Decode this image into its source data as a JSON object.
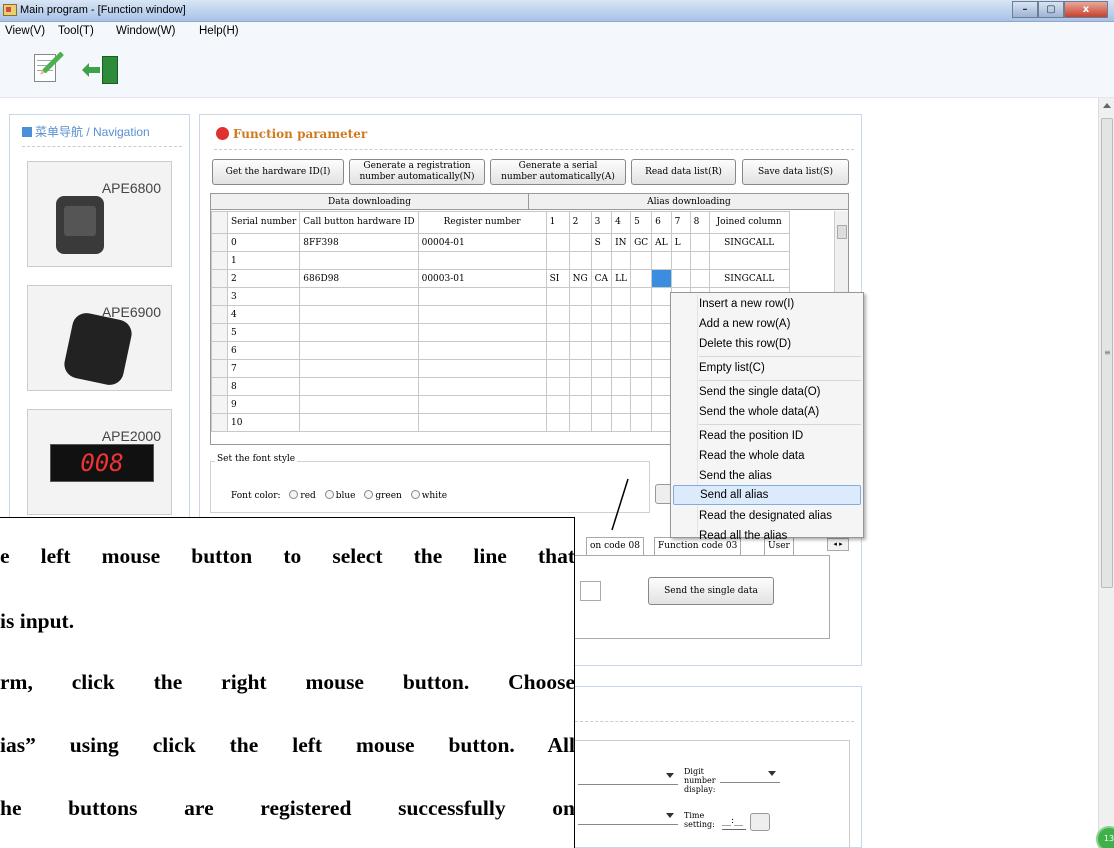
{
  "window": {
    "title": "Main program - [Function window]",
    "controls": {
      "minimize": "–",
      "maximize": "▢",
      "close": "x"
    }
  },
  "menu": [
    "View(V)",
    "Tool(T)",
    "Window(W)",
    "Help(H)"
  ],
  "toolbar": {
    "buttons": [
      "edit-icon",
      "exit-icon"
    ]
  },
  "navigation": {
    "title": "菜单导航 / Navigation",
    "products": [
      {
        "name": "APE6800"
      },
      {
        "name": "APE6900"
      },
      {
        "name": "APE2000",
        "display": "008"
      }
    ]
  },
  "function_panel": {
    "title": "Function parameter",
    "buttons": {
      "get_hw": "Get the hardware ID(I)",
      "gen_reg_1": "Generate a registration",
      "gen_reg_2": "number automatically(N)",
      "gen_serial_1": "Generate a serial",
      "gen_serial_2": "number automatically(A)",
      "read_list": "Read data list(R)",
      "save_list": "Save data list(S)"
    },
    "group_headers": {
      "data": "Data downloading",
      "alias": "Alias downloading"
    },
    "columns": [
      "Serial number",
      "Call button hardware ID",
      "Register number",
      "1",
      "2",
      "3",
      "4",
      "5",
      "6",
      "7",
      "8",
      "Joined column"
    ],
    "rows": [
      {
        "serial": "0",
        "hw": "8FF398",
        "reg": "00004-01",
        "a1": "",
        "a2": "",
        "a3": "S",
        "a4": "IN",
        "a5": "GC",
        "a6": "AL",
        "a7": "L",
        "a8": "",
        "joined": "SINGCALL"
      },
      {
        "serial": "1",
        "hw": "",
        "reg": "",
        "a1": "",
        "a2": "",
        "a3": "",
        "a4": "",
        "a5": "",
        "a6": "",
        "a7": "",
        "a8": "",
        "joined": ""
      },
      {
        "serial": "2",
        "hw": "686D98",
        "reg": "00003-01",
        "a1": "SI",
        "a2": "NG",
        "a3": "CA",
        "a4": "LL",
        "a5": "",
        "a6": "",
        "a7": "",
        "a8": "",
        "joined": "SINGCALL"
      },
      {
        "serial": "3",
        "hw": "",
        "reg": "",
        "a1": "",
        "a2": "",
        "a3": "",
        "a4": "",
        "a5": "",
        "a6": "",
        "a7": "",
        "a8": "",
        "joined": ""
      },
      {
        "serial": "4",
        "hw": "",
        "reg": "",
        "a1": "",
        "a2": "",
        "a3": "",
        "a4": "",
        "a5": "",
        "a6": "",
        "a7": "",
        "a8": "",
        "joined": ""
      },
      {
        "serial": "5",
        "hw": "",
        "reg": "",
        "a1": "",
        "a2": "",
        "a3": "",
        "a4": "",
        "a5": "",
        "a6": "",
        "a7": "",
        "a8": "",
        "joined": ""
      },
      {
        "serial": "6",
        "hw": "",
        "reg": "",
        "a1": "",
        "a2": "",
        "a3": "",
        "a4": "",
        "a5": "",
        "a6": "",
        "a7": "",
        "a8": "",
        "joined": ""
      },
      {
        "serial": "7",
        "hw": "",
        "reg": "",
        "a1": "",
        "a2": "",
        "a3": "",
        "a4": "",
        "a5": "",
        "a6": "",
        "a7": "",
        "a8": "",
        "joined": ""
      },
      {
        "serial": "8",
        "hw": "",
        "reg": "",
        "a1": "",
        "a2": "",
        "a3": "",
        "a4": "",
        "a5": "",
        "a6": "",
        "a7": "",
        "a8": "",
        "joined": ""
      },
      {
        "serial": "9",
        "hw": "",
        "reg": "",
        "a1": "",
        "a2": "",
        "a3": "",
        "a4": "",
        "a5": "",
        "a6": "",
        "a7": "",
        "a8": "",
        "joined": ""
      },
      {
        "serial": "10",
        "hw": "",
        "reg": "",
        "a1": "",
        "a2": "",
        "a3": "",
        "a4": "",
        "a5": "",
        "a6": "",
        "a7": "",
        "a8": "",
        "joined": ""
      }
    ],
    "font_style": {
      "legend": "Set the font style",
      "label": "Font color:",
      "options": [
        "red",
        "blue",
        "green",
        "white"
      ]
    },
    "tabs": [
      "on code 08",
      "Function code 03",
      "User"
    ],
    "send_single": "Send the single data"
  },
  "bottom_panel": {
    "digit_label": "Digit number display:",
    "time_label": "Time setting:",
    "time_value": "__:__"
  },
  "context_menu": {
    "items": [
      "Insert a new row(I)",
      "Add a new row(A)",
      "Delete this row(D)",
      "Empty list(C)",
      "Send the single data(O)",
      "Send the whole data(A)",
      "Read the position ID",
      "Read the whole data",
      "Send the alias",
      "Send all alias",
      "Read the designated alias",
      "Read all the alias"
    ],
    "highlighted": "Send all alias"
  },
  "callout": {
    "lines": [
      "e left mouse button to select the line that",
      "is input.",
      "rm, click the right mouse button. Choose",
      "ias” using click the left mouse button. All",
      "he buttons are registered successfully on"
    ]
  },
  "corner_badge": "13"
}
